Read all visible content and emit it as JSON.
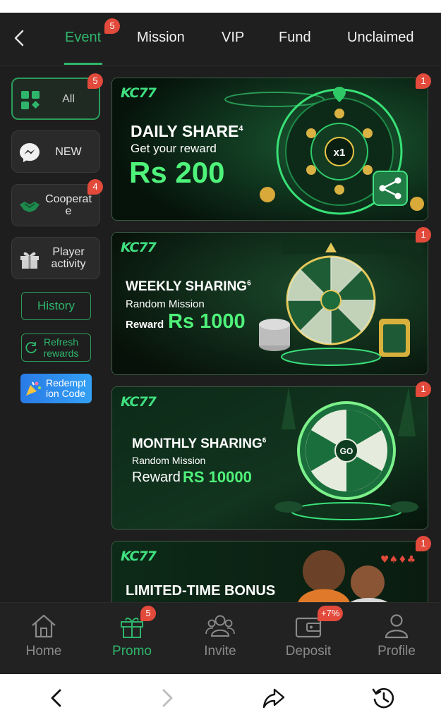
{
  "topnav": {
    "tabs": [
      {
        "label": "Event",
        "active": true,
        "badge": "5"
      },
      {
        "label": "Mission"
      },
      {
        "label": "VIP"
      },
      {
        "label": "Fund"
      },
      {
        "label": "Unclaimed"
      }
    ]
  },
  "sidebar": {
    "items": [
      {
        "label": "All",
        "badge": "5",
        "active": true,
        "icon": "grid-icon"
      },
      {
        "label": "NEW",
        "icon": "messenger-icon"
      },
      {
        "label": "Cooperat\ne",
        "badge": "4",
        "icon": "handshake-icon"
      },
      {
        "label": "Player\nactivity",
        "icon": "gift-icon"
      }
    ],
    "history_label": "History",
    "refresh_label": "Refresh\nrewards",
    "redeem_label": "Redempt\nion Code"
  },
  "banners": [
    {
      "logo": "KC77",
      "title": "DAILY SHARE",
      "title_sup": "4",
      "subtitle": "Get your reward",
      "reward_label": "",
      "amount": "Rs 200",
      "badge": "1"
    },
    {
      "logo": "KC77",
      "title": "WEEKLY SHARING",
      "title_sup": "6",
      "subtitle": "Random Mission",
      "reward_label": "Reward",
      "amount": "Rs 1000",
      "badge": "1"
    },
    {
      "logo": "KC77",
      "title": "MONTHLY SHARING",
      "title_sup": "6",
      "subtitle": "Random Mission",
      "reward_label": "Reward",
      "amount": "RS 10000",
      "badge": "1"
    },
    {
      "logo": "KC77",
      "title": "LIMITED-TIME BONUS",
      "title_sup": "",
      "subtitle": "",
      "reward_label": "",
      "amount": "",
      "badge": "1"
    }
  ],
  "bottomnav": {
    "items": [
      {
        "label": "Home",
        "icon": "home-icon"
      },
      {
        "label": "Promo",
        "icon": "gift-icon",
        "badge": "5",
        "active": true
      },
      {
        "label": "Invite",
        "icon": "users-icon"
      },
      {
        "label": "Deposit",
        "icon": "wallet-icon",
        "badge": "+7%"
      },
      {
        "label": "Profile",
        "icon": "user-icon"
      }
    ]
  },
  "colors": {
    "accent": "#2fb56b",
    "badge": "#e24a3b",
    "background": "#1e1e1e"
  }
}
